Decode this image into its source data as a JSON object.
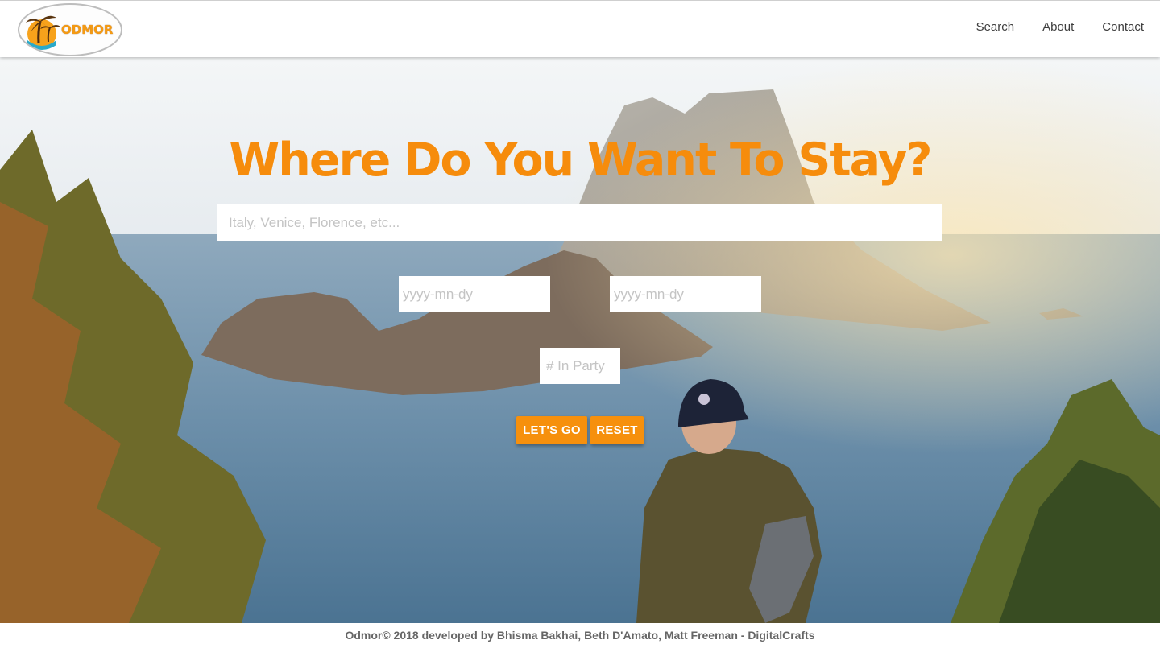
{
  "brand": {
    "logo_text": "ODMOR",
    "accent_color": "#f68c0c"
  },
  "nav": {
    "links": [
      "Search",
      "About",
      "Contact"
    ]
  },
  "hero": {
    "headline": "Where Do You Want To Stay?",
    "destination_placeholder": "Italy, Venice, Florence, etc...",
    "checkin_placeholder": "yyyy-mn-dy",
    "checkout_placeholder": "yyyy-mn-dy",
    "party_placeholder": "# In Party",
    "go_label": "LET'S GO",
    "reset_label": "RESET"
  },
  "footer": {
    "text": "Odmor© 2018 developed by Bhisma Bakhai, Beth D'Amato, Matt Freeman - DigitalCrafts"
  }
}
